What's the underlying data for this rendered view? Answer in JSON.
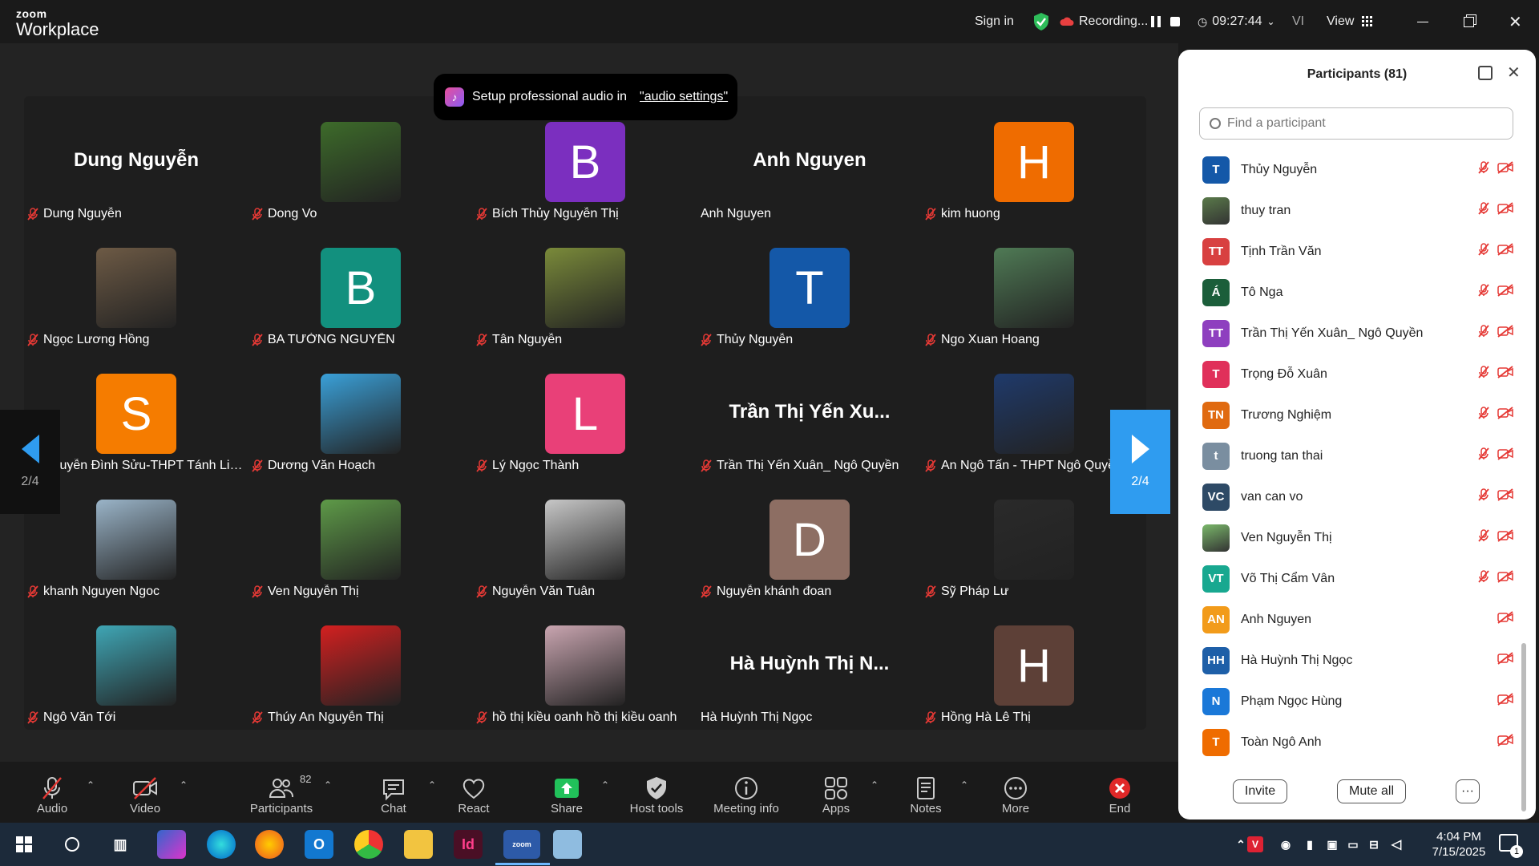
{
  "app": {
    "brand_small": "zoom",
    "brand_big": "Workplace"
  },
  "topbar": {
    "sign_in": "Sign in",
    "recording": "Recording...",
    "time": "09:27:44",
    "lang": "VI",
    "view": "View"
  },
  "toast": {
    "text": "Setup professional audio in",
    "link": "\"audio settings\""
  },
  "nav": {
    "page": "2/4"
  },
  "tiles": [
    {
      "name": "Dung Nguyễn",
      "big": "Dung Nguyễn",
      "type": "name"
    },
    {
      "name": "Dong Vo",
      "type": "photo",
      "color": "#3d6b2a"
    },
    {
      "name": "Bích Thủy Nguyễn Thị",
      "type": "letter",
      "letter": "B",
      "color": "#7b2fbf"
    },
    {
      "name": "Anh Nguyen",
      "big": "Anh Nguyen",
      "type": "name",
      "nomute": true
    },
    {
      "name": "kim huong",
      "type": "letter",
      "letter": "H",
      "color": "#ef6c00"
    },
    {
      "name": "Ngọc Lương Hồng",
      "type": "photo",
      "color": "#6d5a45"
    },
    {
      "name": "BA TƯỜNG NGUYỄN",
      "type": "letter",
      "letter": "B",
      "color": "#12907e"
    },
    {
      "name": "Tân Nguyễn",
      "type": "photo",
      "color": "#7a8a3a"
    },
    {
      "name": "Thủy Nguyễn",
      "type": "letter",
      "letter": "T",
      "color": "#1458a8"
    },
    {
      "name": "Ngo Xuan Hoang",
      "type": "photo",
      "color": "#4f7a55"
    },
    {
      "name": "Nguyễn Đình Sửu-THPT Tánh Linh...",
      "type": "letter",
      "letter": "S",
      "color": "#f57c00"
    },
    {
      "name": "Dương Văn Hoạch",
      "type": "photo",
      "color": "#3aa0d8"
    },
    {
      "name": "Lý Ngọc Thành",
      "type": "letter",
      "letter": "L",
      "color": "#e94078"
    },
    {
      "name": "Trần Thị Yến Xuân_ Ngô Quyền",
      "big": "Trần Thị Yến Xu...",
      "type": "name"
    },
    {
      "name": "An Ngô Tấn - THPT Ngô Quyền, B...",
      "type": "photo",
      "color": "#1f3a6b"
    },
    {
      "name": "khanh Nguyen Ngoc",
      "type": "photo",
      "color": "#9ab4c8"
    },
    {
      "name": "Ven Nguyễn Thị",
      "type": "photo",
      "color": "#5e9a48"
    },
    {
      "name": "Nguyễn Văn Tuân",
      "type": "photo",
      "color": "#c7c7c7"
    },
    {
      "name": "Nguyễn khánh đoan",
      "type": "letter",
      "letter": "D",
      "color": "#8d6e63"
    },
    {
      "name": "Sỹ Pháp Lư",
      "type": "photo",
      "color": "#2a2a2a"
    },
    {
      "name": "Ngô Văn Tới",
      "type": "photo",
      "color": "#3fa6b5"
    },
    {
      "name": "Thúy An Nguyễn Thị",
      "type": "photo",
      "color": "#d32020"
    },
    {
      "name": "hồ thị kiều oanh hồ thị kiều oanh",
      "type": "photo",
      "color": "#c9a5b0"
    },
    {
      "name": "Hà Huỳnh Thị Ngọc",
      "big": "Hà Huỳnh Thị N...",
      "type": "name",
      "nomute": true
    },
    {
      "name": "Hồng Hà Lê Thị",
      "type": "letter",
      "letter": "H",
      "color": "#5d4037"
    }
  ],
  "toolbar": [
    {
      "label": "Audio",
      "icon": "mic-off-icon",
      "caret": true
    },
    {
      "label": "Video",
      "icon": "video-off-icon",
      "caret": true
    },
    {
      "label": "Participants",
      "icon": "participants-icon",
      "caret": true,
      "count": "82"
    },
    {
      "label": "Chat",
      "icon": "chat-icon",
      "caret": true
    },
    {
      "label": "React",
      "icon": "heart-icon"
    },
    {
      "label": "Share",
      "icon": "share-icon",
      "caret": true
    },
    {
      "label": "Host tools",
      "icon": "shield-icon"
    },
    {
      "label": "Meeting info",
      "icon": "info-icon"
    },
    {
      "label": "Apps",
      "icon": "apps-icon",
      "caret": true
    },
    {
      "label": "Notes",
      "icon": "notes-icon",
      "caret": true
    },
    {
      "label": "More",
      "icon": "more-icon"
    },
    {
      "label": "End",
      "icon": "end-icon"
    }
  ],
  "panel": {
    "title": "Participants (81)",
    "search_placeholder": "Find a participant",
    "invite": "Invite",
    "mute_all": "Mute all",
    "more": "···",
    "rows": [
      {
        "initials": "T",
        "name": "Thủy Nguyễn",
        "color": "#1458a8",
        "mic": true
      },
      {
        "initials": "",
        "name": "thuy tran",
        "color": "#5a7a4a",
        "mic": true,
        "photo": true
      },
      {
        "initials": "TT",
        "name": "Tịnh Trần Văn",
        "color": "#d84040",
        "mic": true
      },
      {
        "initials": "Á",
        "name": "Tô Nga",
        "color": "#1b5e3a",
        "mic": true
      },
      {
        "initials": "TT",
        "name": "Trần Thị Yến Xuân_ Ngô Quyền",
        "color": "#8e3fbf",
        "mic": true
      },
      {
        "initials": "T",
        "name": "Trọng Đỗ Xuân",
        "color": "#e0305a",
        "mic": true
      },
      {
        "initials": "TN",
        "name": "Trương Nghiệm",
        "color": "#e06a10",
        "mic": true
      },
      {
        "initials": "t",
        "name": "truong tan thai",
        "color": "#7a8ea0",
        "mic": true
      },
      {
        "initials": "VC",
        "name": "van can vo",
        "color": "#2e4a66",
        "mic": true
      },
      {
        "initials": "",
        "name": "Ven Nguyễn Thị",
        "color": "#7ab86a",
        "mic": true,
        "photo": true
      },
      {
        "initials": "VT",
        "name": "Võ Thị Cẩm Vân",
        "color": "#18a890",
        "mic": true
      },
      {
        "initials": "AN",
        "name": "Anh Nguyen",
        "color": "#f29b1a",
        "mic": false
      },
      {
        "initials": "HH",
        "name": "Hà Huỳnh Thị Ngọc",
        "color": "#1e5fa8",
        "mic": false
      },
      {
        "initials": "N",
        "name": "Phạm Ngọc Hùng",
        "color": "#1a78d8",
        "mic": false
      },
      {
        "initials": "T",
        "name": "Toàn Ngô Anh",
        "color": "#ef6c00",
        "mic": false
      }
    ]
  },
  "taskbar": {
    "time": "4:04 PM",
    "date": "7/15/2025",
    "notif": "1"
  }
}
